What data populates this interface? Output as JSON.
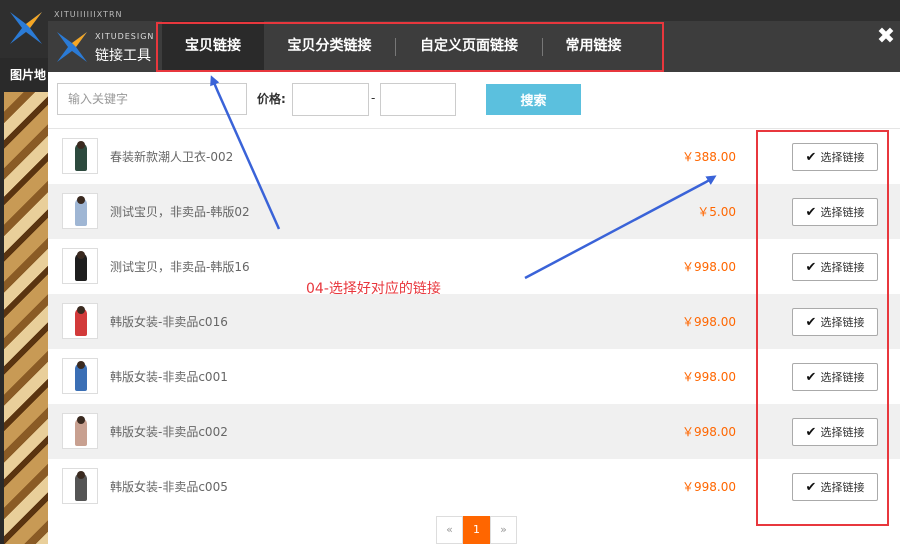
{
  "background": {
    "logo_text": "XITUIIIIIIXTRN",
    "left_label": "图片地"
  },
  "dialog": {
    "brand_small": "XITUDESIGN",
    "brand": "链接工具",
    "close_icon": "close-icon",
    "tabs": [
      {
        "label": "宝贝链接",
        "active": true
      },
      {
        "label": "宝贝分类链接",
        "active": false
      },
      {
        "label": "自定义页面链接",
        "active": false
      },
      {
        "label": "常用链接",
        "active": false
      }
    ],
    "search": {
      "keyword_placeholder": "输入关键字",
      "keyword_value": "",
      "price_label": "价格:",
      "price_min": "",
      "price_separator": "-",
      "price_max": "",
      "button_label": "搜索"
    },
    "select_label": "选择链接",
    "items": [
      {
        "name": "春装新款潮人卫衣-002",
        "price": "￥388.00"
      },
      {
        "name": "测试宝贝，非卖品-韩版02",
        "price": "￥5.00"
      },
      {
        "name": "测试宝贝，非卖品-韩版16",
        "price": "￥998.00"
      },
      {
        "name": "韩版女装-非卖品c016",
        "price": "￥998.00"
      },
      {
        "name": "韩版女装-非卖品c001",
        "price": "￥998.00"
      },
      {
        "name": "韩版女装-非卖品c002",
        "price": "￥998.00"
      },
      {
        "name": "韩版女装-非卖品c005",
        "price": "￥998.00"
      }
    ],
    "pager": {
      "prev": "«",
      "current": "1",
      "next": "»"
    }
  },
  "annotation": {
    "text": "04-选择好对应的链接",
    "color": "#e8373d",
    "arrow_color": "#3a63d8"
  },
  "colors": {
    "accent": "#5bc0de",
    "price": "#ff6600",
    "header": "#3d3d3d"
  }
}
